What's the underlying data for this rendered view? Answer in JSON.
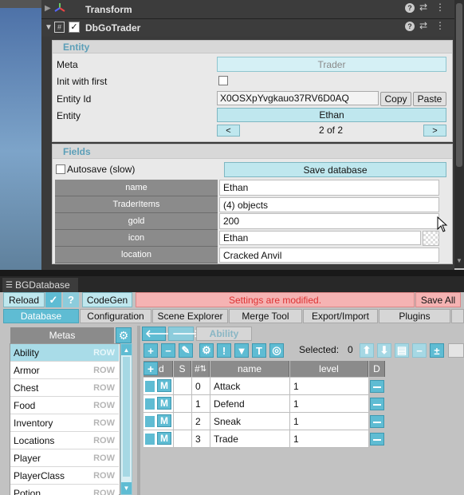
{
  "inspector": {
    "transform_label": "Transform",
    "component_label": "DbGoTrader",
    "entity_section": "Entity",
    "meta_label": "Meta",
    "meta_value": "Trader",
    "init_label": "Init with first",
    "entity_id_label": "Entity Id",
    "entity_id_value": "X0OSXpYvgkauo37RV6D0AQ",
    "copy_label": "Copy",
    "paste_label": "Paste",
    "entity_label": "Entity",
    "entity_value": "Ethan",
    "prev_glyph": "<",
    "next_glyph": ">",
    "pager": "2 of 2",
    "fields_section": "Fields",
    "autosave_label": "Autosave (slow)",
    "save_db_label": "Save database",
    "fields": [
      {
        "name": "name",
        "value": "Ethan"
      },
      {
        "name": "TraderItems",
        "value": "(4) objects"
      },
      {
        "name": "gold",
        "value": "200"
      },
      {
        "name": "icon",
        "value": "Ethan"
      },
      {
        "name": "location",
        "value": "Cracked Anvil"
      }
    ]
  },
  "bgdb": {
    "window_title": "BGDatabase",
    "reload_label": "Reload",
    "codegen_label": "CodeGen",
    "warning": "Settings are modified.",
    "save_all_label": "Save All",
    "tabs": [
      "Database",
      "Configuration",
      "Scene Explorer",
      "Merge Tool",
      "Export/Import",
      "Plugins"
    ],
    "metas_header": "Metas",
    "metas": [
      {
        "name": "Ability",
        "tag": "ROW"
      },
      {
        "name": "Armor",
        "tag": "ROW"
      },
      {
        "name": "Chest",
        "tag": "ROW"
      },
      {
        "name": "Food",
        "tag": "ROW"
      },
      {
        "name": "Inventory",
        "tag": "ROW"
      },
      {
        "name": "Locations",
        "tag": "ROW"
      },
      {
        "name": "Player",
        "tag": "ROW"
      },
      {
        "name": "PlayerClass",
        "tag": "ROW"
      },
      {
        "name": "Potion",
        "tag": "ROW"
      }
    ],
    "current_meta": "Ability",
    "selected_label": "Selected:",
    "selected_count": "0",
    "columns": [
      "d",
      "S",
      "#",
      "name",
      "level",
      "D"
    ],
    "rows": [
      {
        "id": "0",
        "name": "Attack",
        "level": "1"
      },
      {
        "id": "1",
        "name": "Defend",
        "level": "1"
      },
      {
        "id": "2",
        "name": "Sneak",
        "level": "1"
      },
      {
        "id": "3",
        "name": "Trade",
        "level": "1"
      }
    ],
    "m_label": "M"
  }
}
